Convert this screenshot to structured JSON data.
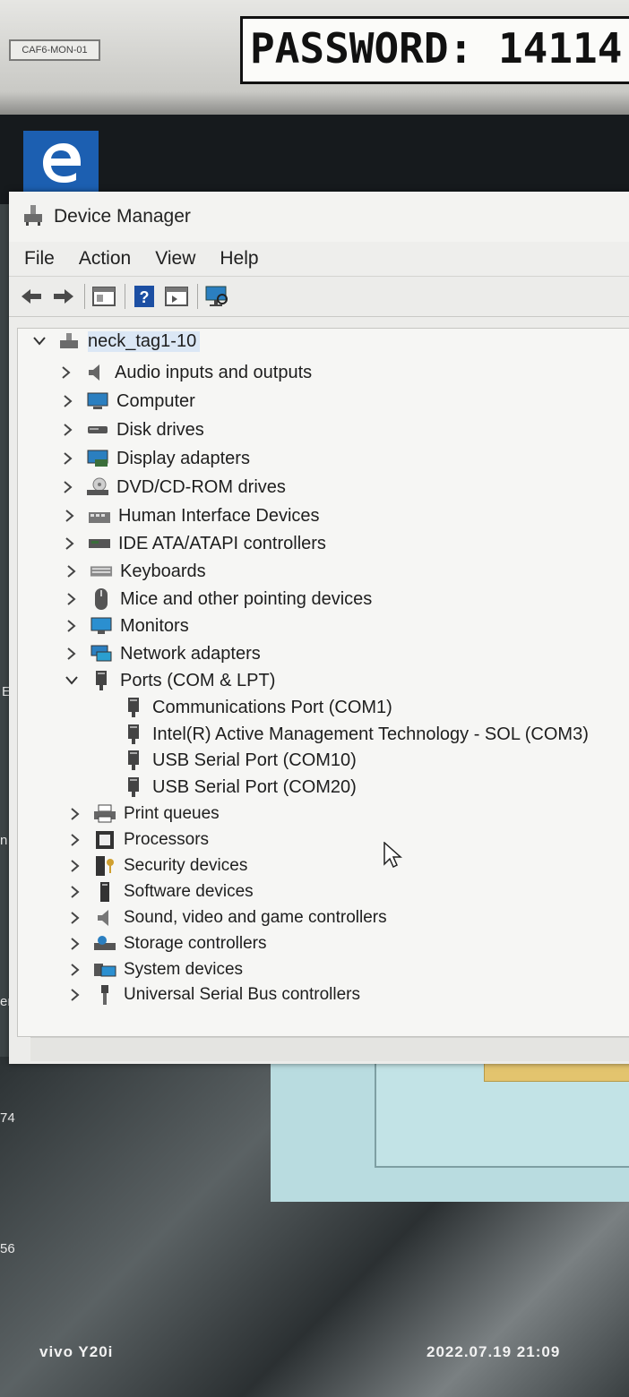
{
  "monitor": {
    "id_label": "CAF6-MON-01",
    "password_note": "PASSWORD: 14114"
  },
  "window": {
    "title": "Device Manager",
    "menu": [
      "File",
      "Action",
      "View",
      "Help"
    ]
  },
  "tree": {
    "root": "neck_tag1-10",
    "categories": [
      "Audio inputs and outputs",
      "Computer",
      "Disk drives",
      "Display adapters",
      "DVD/CD-ROM drives",
      "Human Interface Devices",
      "IDE ATA/ATAPI controllers",
      "Keyboards",
      "Mice and other pointing devices",
      "Monitors",
      "Network adapters",
      "Ports (COM & LPT)"
    ],
    "ports_children": [
      "Communications Port (COM1)",
      "Intel(R) Active Management Technology - SOL (COM3)",
      "USB Serial Port (COM10)",
      "USB Serial Port (COM20)"
    ],
    "categories_after": [
      "Print queues",
      "Processors",
      "Security devices",
      "Software devices",
      "Sound, video and game controllers",
      "Storage controllers",
      "System devices",
      "Universal Serial Bus controllers"
    ]
  },
  "desktop_edge_text": [
    "E",
    "n",
    "er",
    "74",
    "56"
  ],
  "camera_watermark": {
    "device": "vivo Y20i",
    "timestamp": "2022.07.19 21:09"
  }
}
